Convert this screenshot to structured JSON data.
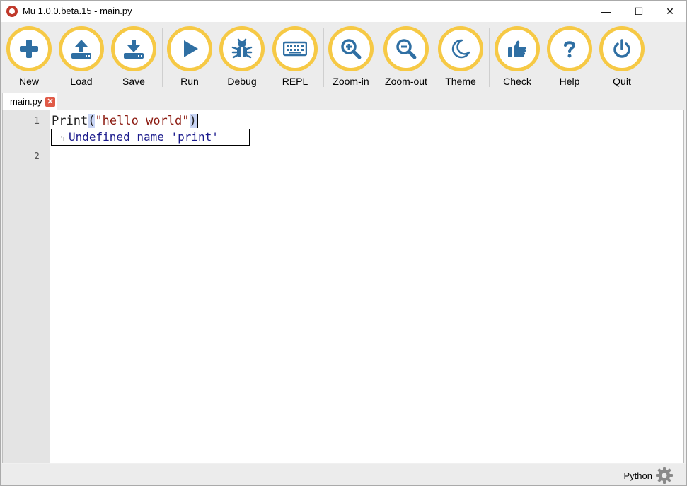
{
  "window": {
    "title": "Mu 1.0.0.beta.15 - main.py",
    "controls": {
      "minimize": "—",
      "maximize": "☐",
      "close": "✕"
    }
  },
  "toolbar": {
    "accent_color": "#f6c945",
    "icon_color": "#2f6fa3",
    "buttons": [
      {
        "label": "New",
        "icon": "plus-icon"
      },
      {
        "label": "Load",
        "icon": "upload-icon"
      },
      {
        "label": "Save",
        "icon": "download-icon"
      },
      {
        "label": "Run",
        "icon": "play-icon"
      },
      {
        "label": "Debug",
        "icon": "bug-icon"
      },
      {
        "label": "REPL",
        "icon": "keyboard-icon"
      },
      {
        "label": "Zoom-in",
        "icon": "zoom-in-icon"
      },
      {
        "label": "Zoom-out",
        "icon": "zoom-out-icon"
      },
      {
        "label": "Theme",
        "icon": "moon-icon"
      },
      {
        "label": "Check",
        "icon": "thumbs-up-icon"
      },
      {
        "label": "Help",
        "icon": "question-icon"
      },
      {
        "label": "Quit",
        "icon": "power-icon"
      }
    ]
  },
  "tabs": [
    {
      "label": "main.py",
      "close": "✕"
    }
  ],
  "editor": {
    "line_numbers": [
      "1",
      "2"
    ],
    "line1": {
      "name": "Print",
      "open_paren": "(",
      "string": "\"hello world\"",
      "close_paren": ")"
    },
    "annotation": "Undefined name 'print'"
  },
  "statusbar": {
    "mode": "Python",
    "settings_icon": "gear-icon"
  }
}
